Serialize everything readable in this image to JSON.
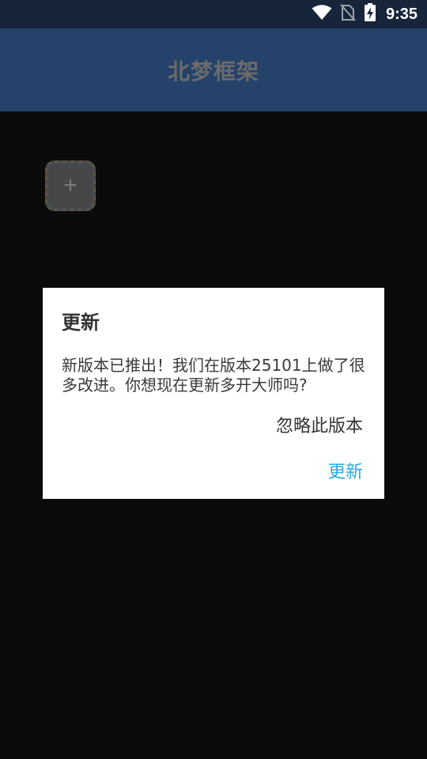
{
  "status_bar": {
    "time": "9:35",
    "icons": [
      "wifi-icon",
      "no-sim-icon",
      "battery-charging-icon"
    ]
  },
  "app_bar": {
    "title": "北梦框架"
  },
  "add_tile": {
    "icon": "plus-icon",
    "symbol": "+"
  },
  "dialog": {
    "title": "更新",
    "message": "新版本已推出！我们在版本25101上做了很多改进。你想现在更新多开大师吗?",
    "ignore_label": "忽略此版本",
    "update_label": "更新"
  },
  "colors": {
    "status_bar_bg": "#17253a",
    "app_bar_bg": "#24426a",
    "background": "#0b0b0b",
    "dialog_bg": "#ffffff",
    "accent": "#2ba8e0"
  }
}
